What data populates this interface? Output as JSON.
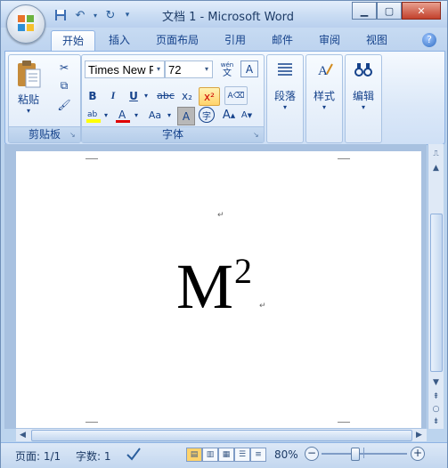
{
  "window": {
    "title": "文档 1 - Microsoft Word",
    "min_label": "▁",
    "max_label": "▢",
    "close_label": "✕"
  },
  "qat": {
    "icons": [
      "save-icon",
      "undo-icon",
      "redo-icon",
      "customize-qat-icon"
    ]
  },
  "tabs": [
    {
      "label": "开始",
      "active": true
    },
    {
      "label": "插入"
    },
    {
      "label": "页面布局"
    },
    {
      "label": "引用"
    },
    {
      "label": "邮件"
    },
    {
      "label": "审阅"
    },
    {
      "label": "视图"
    }
  ],
  "ribbon": {
    "clipboard": {
      "label": "剪贴板",
      "paste_label": "粘贴"
    },
    "font": {
      "label": "字体",
      "font_name": "Times New F",
      "font_size": "72",
      "bold": "B",
      "italic": "I",
      "underline": "U",
      "strike": "abc",
      "subscript": "x₂",
      "superscript": "x²",
      "char_shading": "A",
      "enclose": "字",
      "grow": "A",
      "shrink": "A",
      "text_effect": "Aa",
      "wen": "文",
      "wen_small": "wén"
    },
    "paragraph": {
      "label": "段落"
    },
    "styles": {
      "label": "样式"
    },
    "editing": {
      "label": "编辑"
    }
  },
  "document": {
    "main_text": "M",
    "superscript_text": "2",
    "para_mark": "↵"
  },
  "status": {
    "page": "页面: 1/1",
    "words": "字数: 1",
    "zoom": "80%"
  },
  "colors": {
    "accent": "#15428b",
    "ribbon_bg": "#dbe8f8",
    "highlight_yellow": "#ffff00",
    "font_red": "#e00000"
  }
}
